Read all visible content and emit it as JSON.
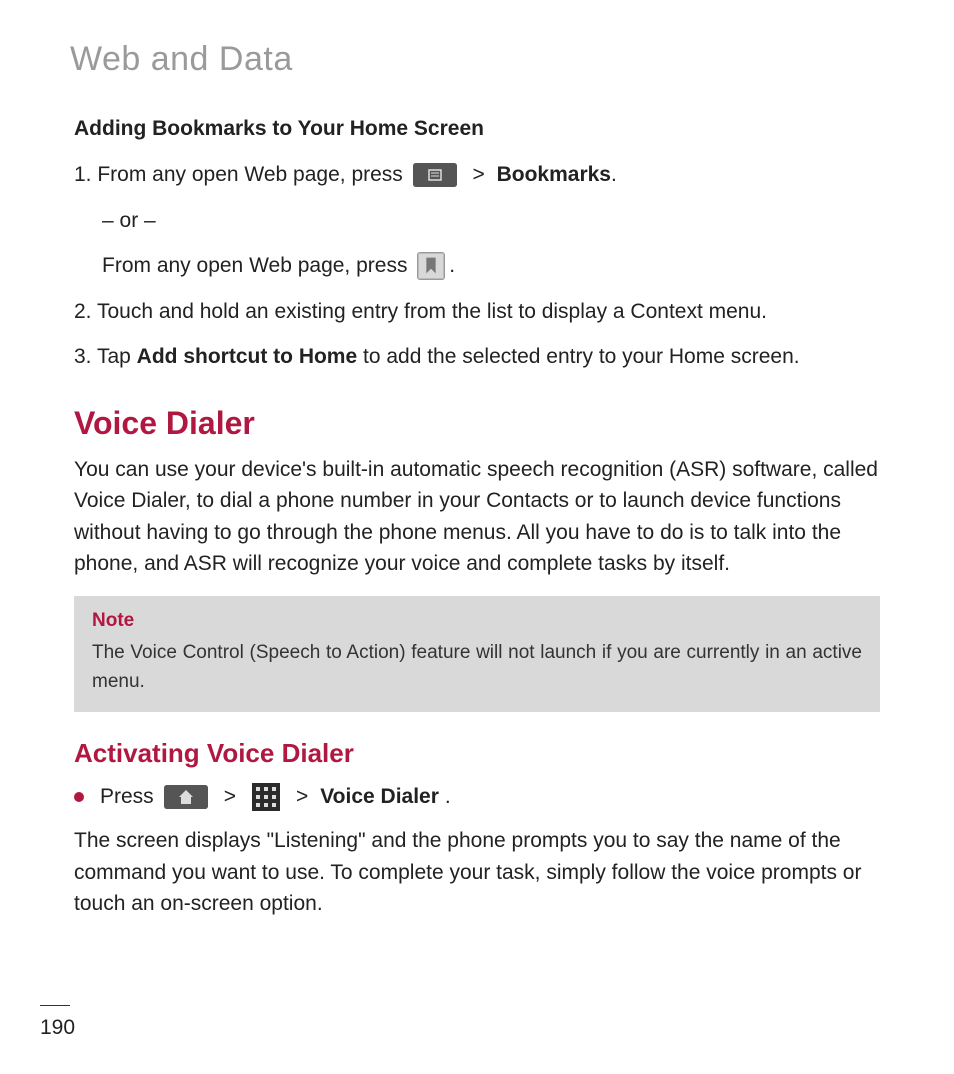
{
  "header": "Web and Data",
  "section1": {
    "title": "Adding Bookmarks to Your Home Screen",
    "step1_pre": "1. From any open Web page, press ",
    "step1_gt": ">",
    "step1_bold": "Bookmarks",
    "step1_post": ".",
    "or": "– or –",
    "alt": "From any open Web page, press ",
    "alt_post": ".",
    "step2_pre": "2. Touch and hold an existing entry from the list to display a Context menu.",
    "step3_pre": "3. Tap ",
    "step3_bold": "Add shortcut to Home",
    "step3_post": " to add the selected entry to your Home screen."
  },
  "section2": {
    "title": "Voice Dialer",
    "body": "You can use your device's built-in automatic speech recognition (ASR) software, called Voice Dialer, to dial a phone number in your Contacts or to launch device functions without having to go through the phone menus. All you have to do is to talk into the phone, and ASR will recognize your voice and complete tasks by itself."
  },
  "note": {
    "label": "Note",
    "text": "The Voice Control (Speech to Action) feature will not launch if you are currently in an active menu."
  },
  "section3": {
    "title": "Activating Voice Dialer",
    "press": "Press ",
    "gt1": ">",
    "gt2": ">",
    "voice_dialer": "Voice Dialer",
    "post": ".",
    "body": "The screen displays \"Listening\" and the phone prompts you to say the name of the command you want to use. To complete your task, simply follow the voice prompts or touch an on-screen option."
  },
  "page_number": "190"
}
